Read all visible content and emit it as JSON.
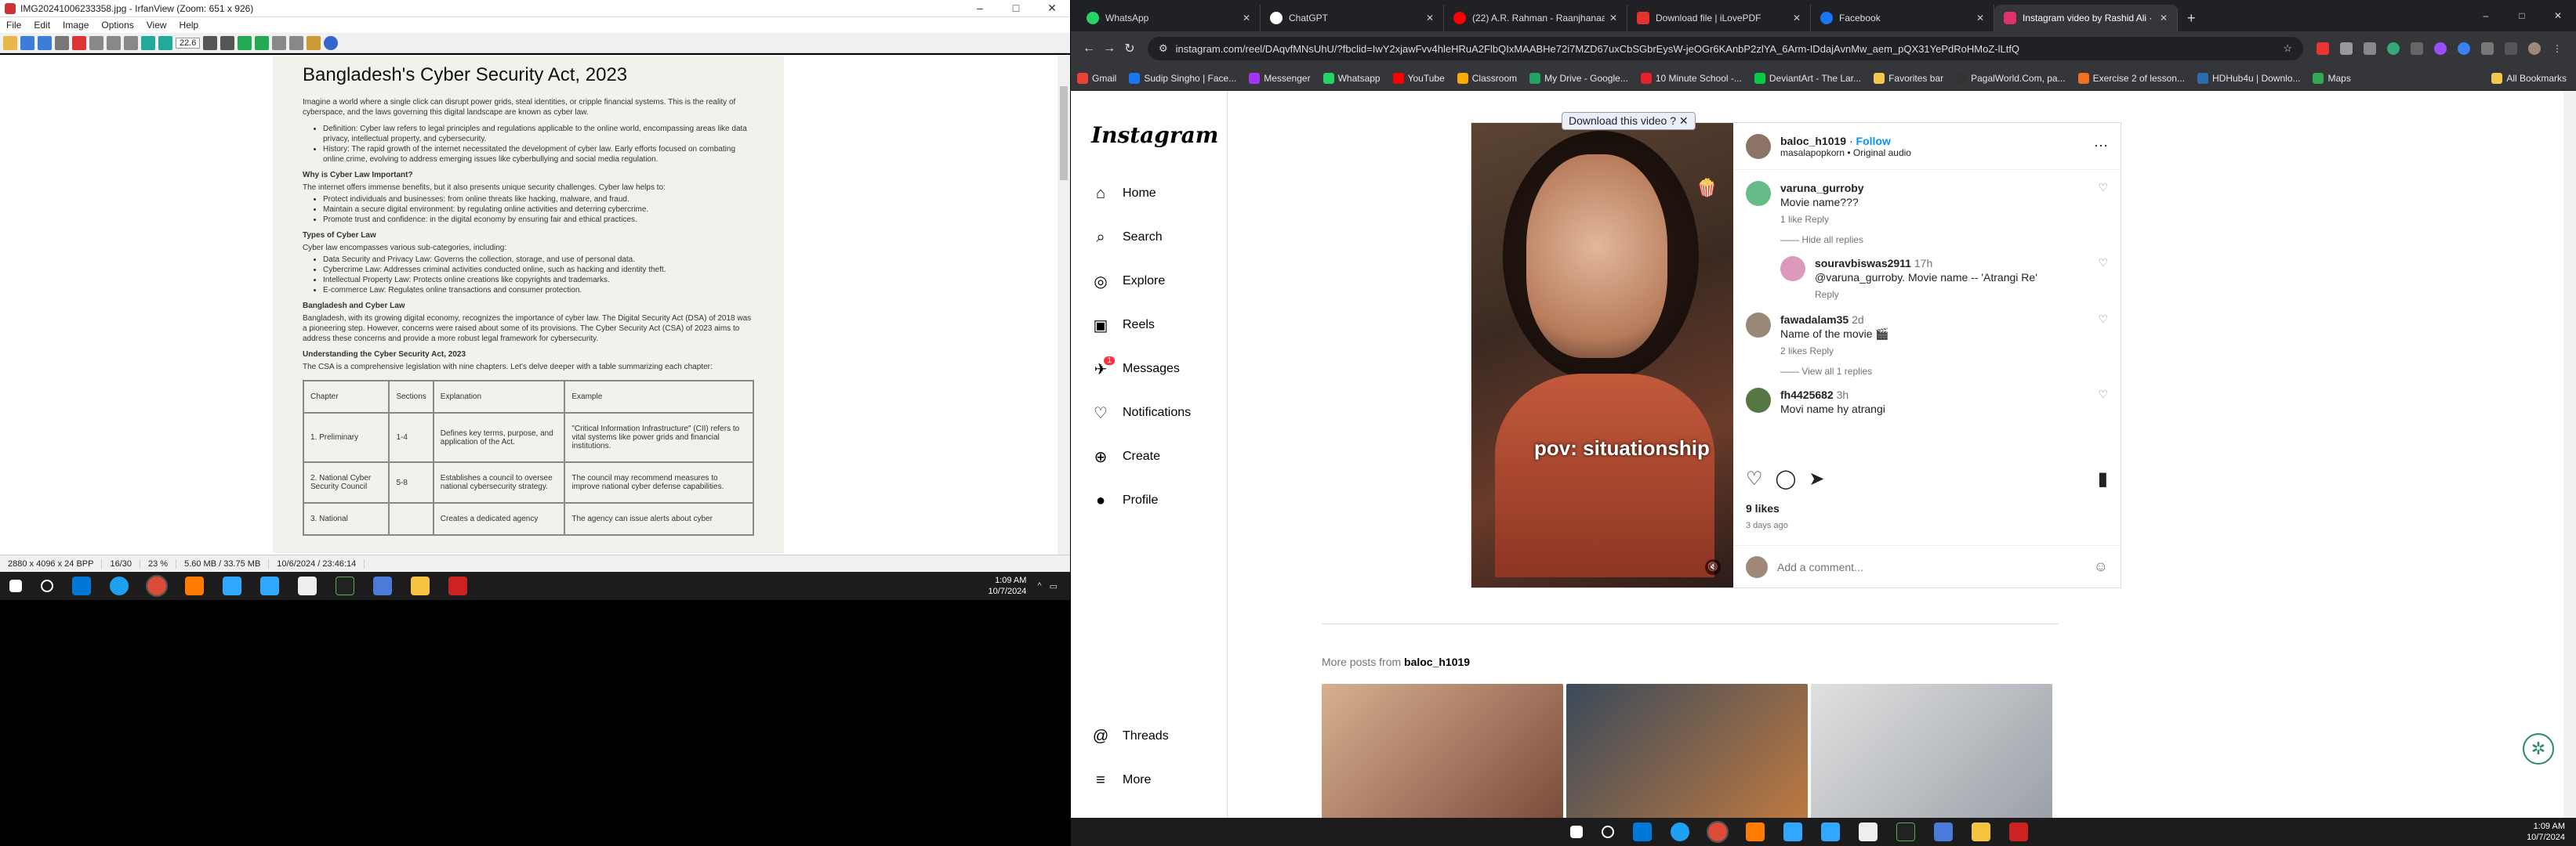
{
  "irfanview": {
    "title": "IMG20241006233358.jpg - IrfanView (Zoom: 651 x 926)",
    "menu": [
      "File",
      "Edit",
      "Image",
      "Options",
      "View",
      "Help"
    ],
    "zoom": "22.6",
    "status": [
      "2880 x 4096 x 24 BPP",
      "16/30",
      "23 %",
      "5.60 MB / 33.75 MB",
      "10/6/2024 / 23:46:14"
    ]
  },
  "document": {
    "title": "Bangladesh's Cyber Security Act, 2023",
    "intro": "Imagine a world where a single click can disrupt power grids, steal identities, or cripple financial systems. This is the reality of cyberspace, and the laws governing this digital landscape are known as cyber law.",
    "def": "Definition: Cyber law refers to legal principles and regulations applicable to the online world, encompassing areas like data privacy, intellectual property, and cybersecurity.",
    "hist": "History: The rapid growth of the internet necessitated the development of cyber law. Early efforts focused on combating online crime, evolving to address emerging issues like cyberbullying and social media regulation.",
    "why_h": "Why is Cyber Law Important?",
    "why_p": "The internet offers immense benefits, but it also presents unique security challenges. Cyber law helps to:",
    "why_items": [
      "Protect individuals and businesses: from online threats like hacking, malware, and fraud.",
      "Maintain a secure digital environment: by regulating online activities and deterring cybercrime.",
      "Promote trust and confidence: in the digital economy by ensuring fair and ethical practices."
    ],
    "types_h": "Types of Cyber Law",
    "types_p": "Cyber law encompasses various sub-categories, including:",
    "types_items": [
      "Data Security and Privacy Law: Governs the collection, storage, and use of personal data.",
      "Cybercrime Law: Addresses criminal activities conducted online, such as hacking and identity theft.",
      "Intellectual Property Law: Protects online creations like copyrights and trademarks.",
      "E-commerce Law: Regulates online transactions and consumer protection."
    ],
    "bd_h": "Bangladesh and Cyber Law",
    "bd_p": "Bangladesh, with its growing digital economy, recognizes the importance of cyber law. The Digital Security Act (DSA) of 2018 was a pioneering step. However, concerns were raised about some of its provisions. The Cyber Security Act (CSA) of 2023 aims to address these concerns and provide a more robust legal framework for cybersecurity.",
    "und_h": "Understanding the Cyber Security Act, 2023",
    "und_p": "The CSA is a comprehensive legislation with nine chapters. Let's delve deeper with a table summarizing each chapter:",
    "table_head": [
      "Chapter",
      "Sections",
      "Explanation",
      "Example"
    ],
    "rows": [
      [
        "1. Preliminary",
        "1-4",
        "Defines key terms, purpose, and application of the Act.",
        "\"Critical Information Infrastructure\" (CII) refers to vital systems like power grids and financial institutions."
      ],
      [
        "2. National Cyber Security Council",
        "5-8",
        "Establishes a council to oversee national cybersecurity strategy.",
        "The council may recommend measures to improve national cyber defense capabilities."
      ],
      [
        "3. National",
        "",
        "Creates a dedicated agency",
        "The agency can issue alerts about cyber"
      ]
    ]
  },
  "left_taskbar": {
    "time": "1:09 AM",
    "date": "10/7/2024"
  },
  "chrome": {
    "tabs": [
      {
        "title": "WhatsApp",
        "color": "#25d366"
      },
      {
        "title": "ChatGPT",
        "color": "#ffffff"
      },
      {
        "title": "(22) A.R. Rahman - Raanjhanaa",
        "color": "#ff0000"
      },
      {
        "title": "Download file | iLovePDF",
        "color": "#e5322d"
      },
      {
        "title": "Facebook",
        "color": "#1877f2"
      },
      {
        "title": "Instagram video by Rashid Ali ·",
        "color": "#e1306c"
      }
    ],
    "url": "instagram.com/reel/DAqvfMNsUhU/?fbclid=IwY2xjawFvv4hleHRuA2FlbQIxMAABHe72i7MZD67uxCbSGbrEysW-jeOGr6KAnbP2zlYA_6Arm-IDdajAvnMw_aem_pQX31YePdRoHMoZ-lLtfQ",
    "bookmarks": [
      {
        "label": "Gmail",
        "color": "#ea4335"
      },
      {
        "label": "Sudip Singho | Face...",
        "color": "#1877f2"
      },
      {
        "label": "Messenger",
        "color": "#a334fa"
      },
      {
        "label": "Whatsapp",
        "color": "#25d366"
      },
      {
        "label": "YouTube",
        "color": "#ff0000"
      },
      {
        "label": "Classroom",
        "color": "#f9ab00"
      },
      {
        "label": "My Drive - Google...",
        "color": "#1fa463"
      },
      {
        "label": "10 Minute School -...",
        "color": "#e8212a"
      },
      {
        "label": "DeviantArt - The Lar...",
        "color": "#05cc47"
      },
      {
        "label": "Favorites bar",
        "color": "#f2c94c"
      },
      {
        "label": "PagalWorld.Com, pa...",
        "color": "#333333"
      },
      {
        "label": "Exercise 2 of lesson...",
        "color": "#f37021"
      },
      {
        "label": "HDHub4u | Downlo...",
        "color": "#2b6cb0"
      },
      {
        "label": "Maps",
        "color": "#34a853"
      }
    ],
    "all_bookmarks": "All Bookmarks"
  },
  "instagram": {
    "logo": "Instagram",
    "nav": [
      {
        "label": "Home",
        "icon": "⌂"
      },
      {
        "label": "Search",
        "icon": "⌕"
      },
      {
        "label": "Explore",
        "icon": "◎"
      },
      {
        "label": "Reels",
        "icon": "▣"
      },
      {
        "label": "Messages",
        "icon": "✈"
      },
      {
        "label": "Notifications",
        "icon": "♡"
      },
      {
        "label": "Create",
        "icon": "⊕"
      },
      {
        "label": "Profile",
        "icon": "●"
      }
    ],
    "messages_badge": "1",
    "bottom_nav": [
      {
        "label": "Threads",
        "icon": "@"
      },
      {
        "label": "More",
        "icon": "≡"
      }
    ],
    "download_label": "Download this video",
    "caption": "pov: situationship",
    "user": "baloc_h1019",
    "follow": "Follow",
    "audio": "masalapopkorn • Original audio",
    "comments": [
      {
        "user": "varuna_gurroby",
        "text": "Movie name???",
        "meta": "1 like   Reply",
        "sub": "——  Hide all replies"
      },
      {
        "user": "souravbiswas2911",
        "time": "17h",
        "text": "@varuna_gurroby. Movie name -- 'Atrangi Re'",
        "meta": "Reply",
        "sub": ""
      },
      {
        "user": "fawadalam35",
        "time": "2d",
        "text": "Name of the movie 🎬",
        "meta": "2 likes   Reply",
        "sub": "——  View all 1 replies"
      },
      {
        "user": "fh4425682",
        "time": "3h",
        "text": "Movi name hy atrangi",
        "meta": "",
        "sub": ""
      }
    ],
    "likes": "9 likes",
    "ago": "3 days ago",
    "add_comment": "Add a comment...",
    "more_posts": "More posts from",
    "more_user": "baloc_h1019"
  },
  "right_taskbar": {
    "time": "1:09 AM",
    "date": "10/7/2024"
  }
}
